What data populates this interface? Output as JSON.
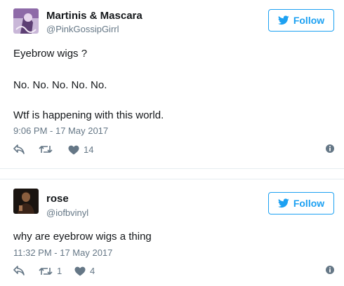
{
  "tweets": [
    {
      "name": "Martinis & Mascara",
      "handle": "@PinkGossipGirrl",
      "follow_label": "Follow",
      "lines": [
        "Eyebrow wigs ?",
        "No. No. No. No. No.",
        "Wtf is happening with this world."
      ],
      "timestamp": "9:06 PM - 17 May 2017",
      "retweets": "",
      "likes": "14"
    },
    {
      "name": "rose",
      "handle": "@iofbvinyl",
      "follow_label": "Follow",
      "lines": [
        "why are eyebrow wigs a thing"
      ],
      "timestamp": "11:32 PM - 17 May 2017",
      "retweets": "1",
      "likes": "4"
    }
  ],
  "colors": {
    "accent": "#1da1f2",
    "secondary_text": "#657786",
    "primary_text": "#14171a"
  },
  "icons": [
    "twitter-bird-icon",
    "reply-icon",
    "retweet-icon",
    "heart-icon",
    "more-info-icon"
  ]
}
